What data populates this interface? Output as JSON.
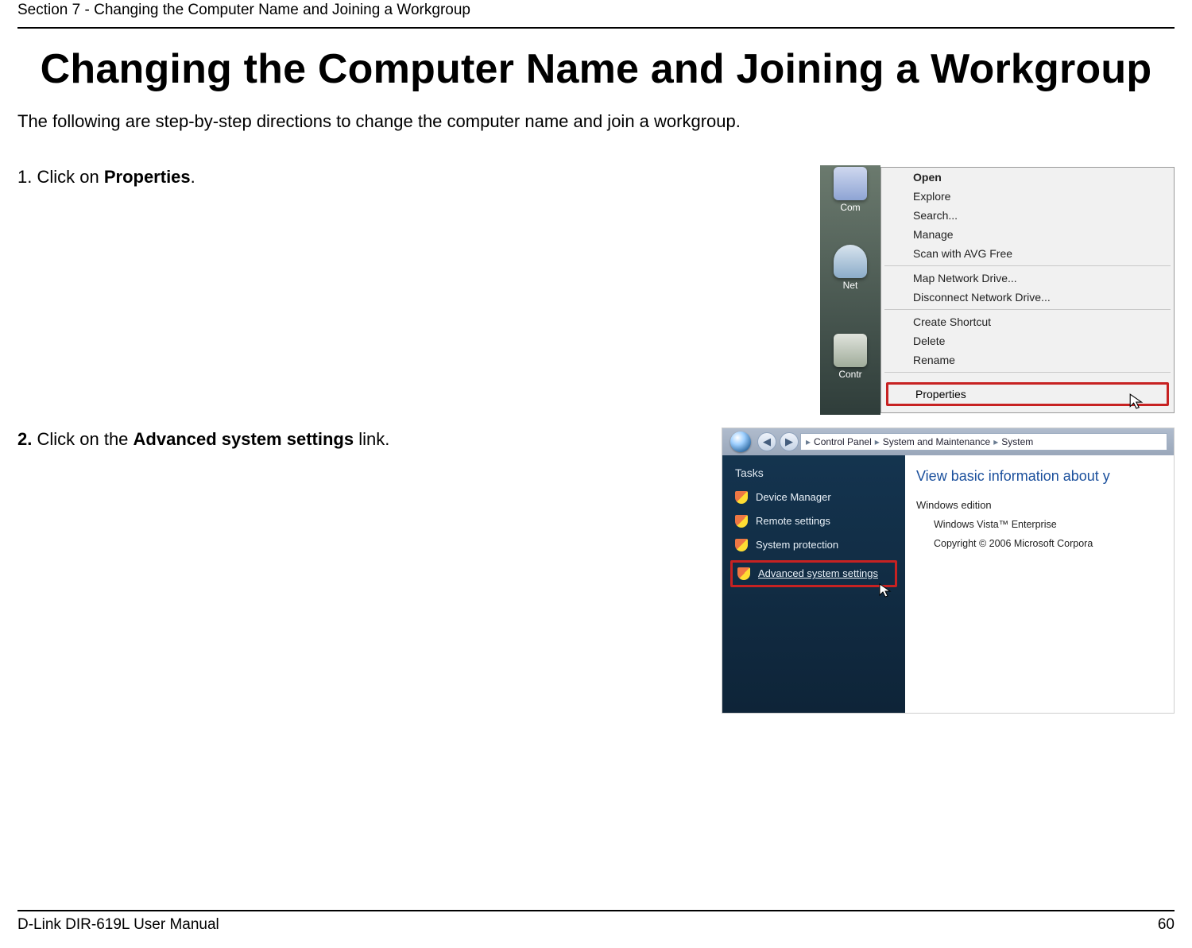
{
  "header": {
    "section_label": "Section 7 - Changing the Computer Name and Joining a Workgroup"
  },
  "title": "Changing the Computer Name and Joining a Workgroup",
  "intro": "The following are step-by-step directions to change the computer name and join a workgroup.",
  "steps": {
    "s1_prefix": "1. Click on ",
    "s1_bold": "Properties",
    "s1_suffix": ".",
    "s2_prefix": "2.",
    "s2_mid": " Click on the ",
    "s2_bold": "Advanced system settings",
    "s2_suffix": " link."
  },
  "context_menu": {
    "desk_icon_computer": "Com",
    "desk_icon_network": "Net",
    "desk_icon_control": "Contr",
    "items_top": [
      "Open",
      "Explore",
      "Search...",
      "Manage",
      "Scan with AVG Free"
    ],
    "items_mid": [
      "Map Network Drive...",
      "Disconnect Network Drive..."
    ],
    "items_bot": [
      "Create Shortcut",
      "Delete",
      "Rename"
    ],
    "properties": "Properties"
  },
  "system_window": {
    "crumb1": "Control Panel",
    "crumb2": "System and Maintenance",
    "crumb3": "System",
    "tasks_title": "Tasks",
    "task_device": "Device Manager",
    "task_remote": "Remote settings",
    "task_protection": "System protection",
    "task_advanced": "Advanced system settings",
    "right_heading": "View basic information about y",
    "right_sub": "Windows edition",
    "right_line1": "Windows Vista™ Enterprise",
    "right_line2": "Copyright © 2006 Microsoft Corpora"
  },
  "footer": {
    "manual": "D-Link DIR-619L User Manual",
    "page_no": "60"
  }
}
